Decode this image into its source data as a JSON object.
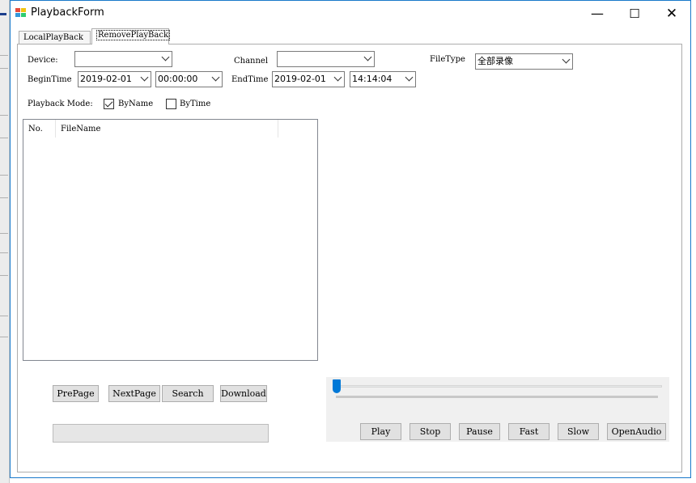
{
  "window": {
    "title": "PlaybackForm",
    "app_icon": "playback-app-icon",
    "controls": {
      "minimize": "—",
      "maximize": "☐",
      "close": "✕"
    }
  },
  "tabs": [
    {
      "label": "LocalPlayBack",
      "selected": false
    },
    {
      "label": "RemovePlayBack",
      "selected": true
    }
  ],
  "filters": {
    "device_label": "Device:",
    "device_value": "",
    "channel_label": "Channel",
    "channel_value": "",
    "filetype_label": "FileType",
    "filetype_value": "全部录像",
    "begin_label": "BeginTime",
    "begin_date": "2019-02-01",
    "begin_time": "00:00:00",
    "end_label": "EndTime",
    "end_date": "2019-02-01",
    "end_time": "14:14:04"
  },
  "mode": {
    "label": "Playback Mode:",
    "by_name_label": "ByName",
    "by_name_checked": true,
    "by_time_label": "ByTime",
    "by_time_checked": false
  },
  "file_list": {
    "columns": [
      "No.",
      "FileName"
    ],
    "rows": []
  },
  "paging": {
    "prev_label": "PrePage",
    "next_label": "NextPage",
    "search_label": "Search",
    "download_label": "Download",
    "progress": 0
  },
  "player": {
    "position": 0,
    "play_label": "Play",
    "stop_label": "Stop",
    "pause_label": "Pause",
    "fast_label": "Fast",
    "slow_label": "Slow",
    "audio_label": "OpenAudio"
  },
  "colors": {
    "accent": "#0078d7",
    "window_border": "#1979ca",
    "button_face": "#e1e1e1",
    "player_bg": "#f0f0f0"
  }
}
